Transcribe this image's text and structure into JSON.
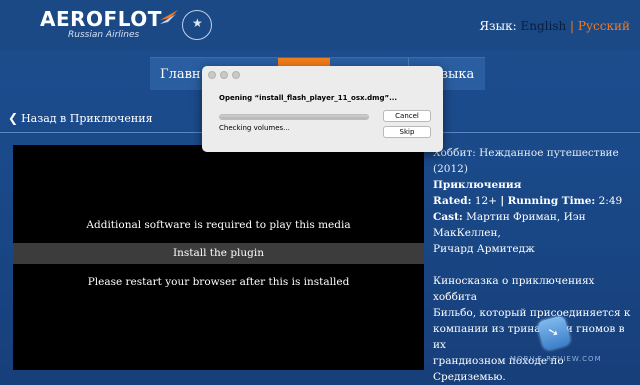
{
  "header": {
    "logo_text": "AEROFLOT",
    "logo_subtitle": "Russian Airlines",
    "language": {
      "label": "Язык:",
      "english": "English",
      "separator": "|",
      "russian": "Русский"
    }
  },
  "nav": {
    "items": [
      {
        "label": "Главн"
      },
      {
        "label": ""
      },
      {
        "label": ""
      },
      {
        "label": "Музыка"
      }
    ]
  },
  "back_link": {
    "label": "Назад в Приключения"
  },
  "player": {
    "message": "Additional software is required to play this media",
    "install_label": "Install the plugin",
    "restart_message": "Please restart your browser after this is installed"
  },
  "movie": {
    "title": "Хоббит: Нежданное путешествие (2012)",
    "genre": "Приключения",
    "rated_label": "Rated:",
    "rated_value": "12+",
    "divider": "|",
    "running_label": "Running Time:",
    "running_value": "2:49",
    "cast_label": "Cast:",
    "cast_line1": "Мартин Фриман, Иэн МакКеллен,",
    "cast_line2": "Ричард Армитедж",
    "description_lines": [
      "Киносказка о приключениях хоббита",
      "Бильбо, который присоединяется к",
      "компании из тринадцати гномов в их",
      "грандиозном походе по Средиземью."
    ]
  },
  "watermark": {
    "text": "MOBILE-REVIEW.COM"
  },
  "dialog": {
    "title": "Opening “install_flash_player_11_osx.dmg”...",
    "status": "Checking volumes...",
    "progress": 1.0,
    "cancel_label": "Cancel",
    "skip_label": "Skip"
  },
  "colors": {
    "accent_orange": "#f07d19",
    "page_blue": "#1a4a8a",
    "nav_blue": "#2a5ea1"
  }
}
